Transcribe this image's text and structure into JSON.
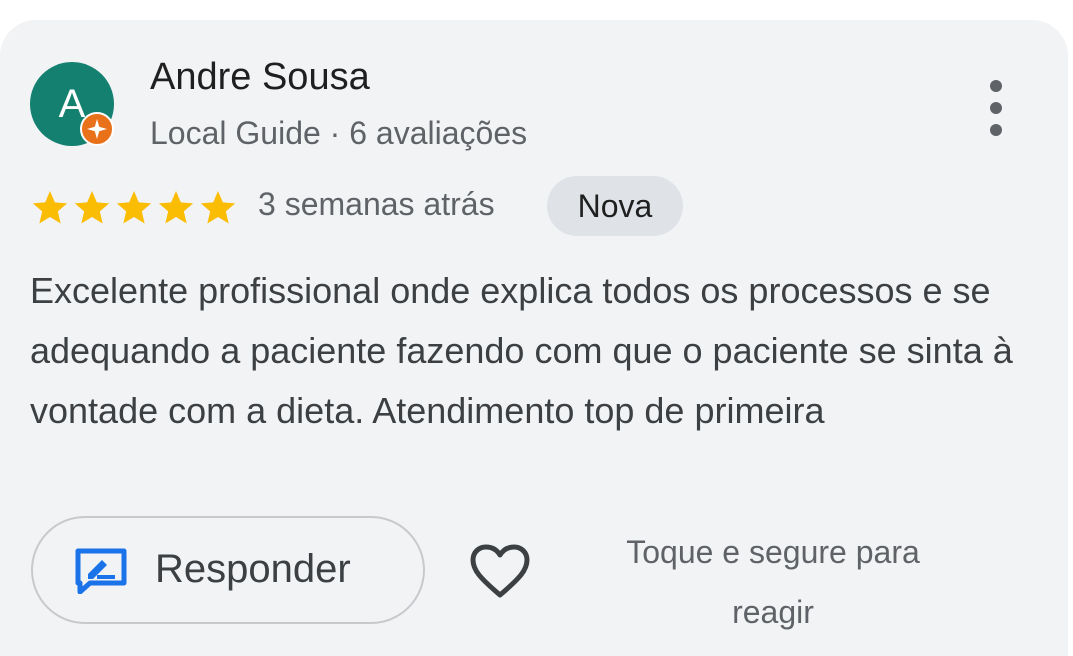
{
  "review": {
    "author": {
      "initial": "A",
      "name": "Andre Sousa",
      "meta": "Local Guide · 6 avaliações",
      "avatar_color": "#14806f",
      "badge_color": "#e8711a"
    },
    "rating": 5,
    "max_rating": 5,
    "star_color": "#fbbc04",
    "time_ago": "3 semanas atrás",
    "badge": "Nova",
    "text": "Excelente profissional onde explica todos os processos e se adequando a paciente fazendo com que o paciente se sinta à vontade com a dieta. Atendimento top de primeira"
  },
  "actions": {
    "reply_label": "Responder",
    "reply_icon": "reply-edit-icon",
    "like_icon": "heart-outline-icon",
    "react_hint": "Toque e segure para reagir",
    "more_icon": "more-vertical-icon",
    "accent": "#1a73e8"
  }
}
